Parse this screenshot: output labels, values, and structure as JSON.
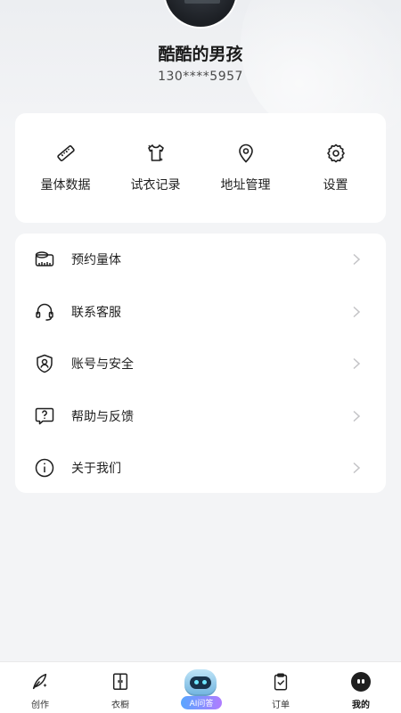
{
  "profile": {
    "username": "酷酷的男孩",
    "phone": "130****5957"
  },
  "quick_actions": [
    {
      "label": "量体数据",
      "icon": "ruler-icon"
    },
    {
      "label": "试衣记录",
      "icon": "shirt-icon"
    },
    {
      "label": "地址管理",
      "icon": "location-pin-icon"
    },
    {
      "label": "设置",
      "icon": "gear-icon"
    }
  ],
  "menu": [
    {
      "label": "预约量体",
      "icon": "tape-measure-icon"
    },
    {
      "label": "联系客服",
      "icon": "headset-icon"
    },
    {
      "label": "账号与安全",
      "icon": "shield-user-icon"
    },
    {
      "label": "帮助与反馈",
      "icon": "help-chat-icon"
    },
    {
      "label": "关于我们",
      "icon": "info-icon"
    }
  ],
  "tabbar": {
    "tabs": [
      {
        "label": "创作",
        "icon": "feather-pen-icon"
      },
      {
        "label": "衣橱",
        "icon": "wardrobe-icon"
      },
      {
        "label": "AI问答",
        "icon": "robot-icon"
      },
      {
        "label": "订单",
        "icon": "clipboard-check-icon"
      },
      {
        "label": "我的",
        "icon": "profile-face-icon",
        "active": true
      }
    ]
  },
  "colors": {
    "background": "#f3f4f6",
    "card": "#ffffff",
    "text": "#1f1f1f",
    "ai_gradient_start": "#58a6ff",
    "ai_gradient_end": "#b07cff"
  }
}
